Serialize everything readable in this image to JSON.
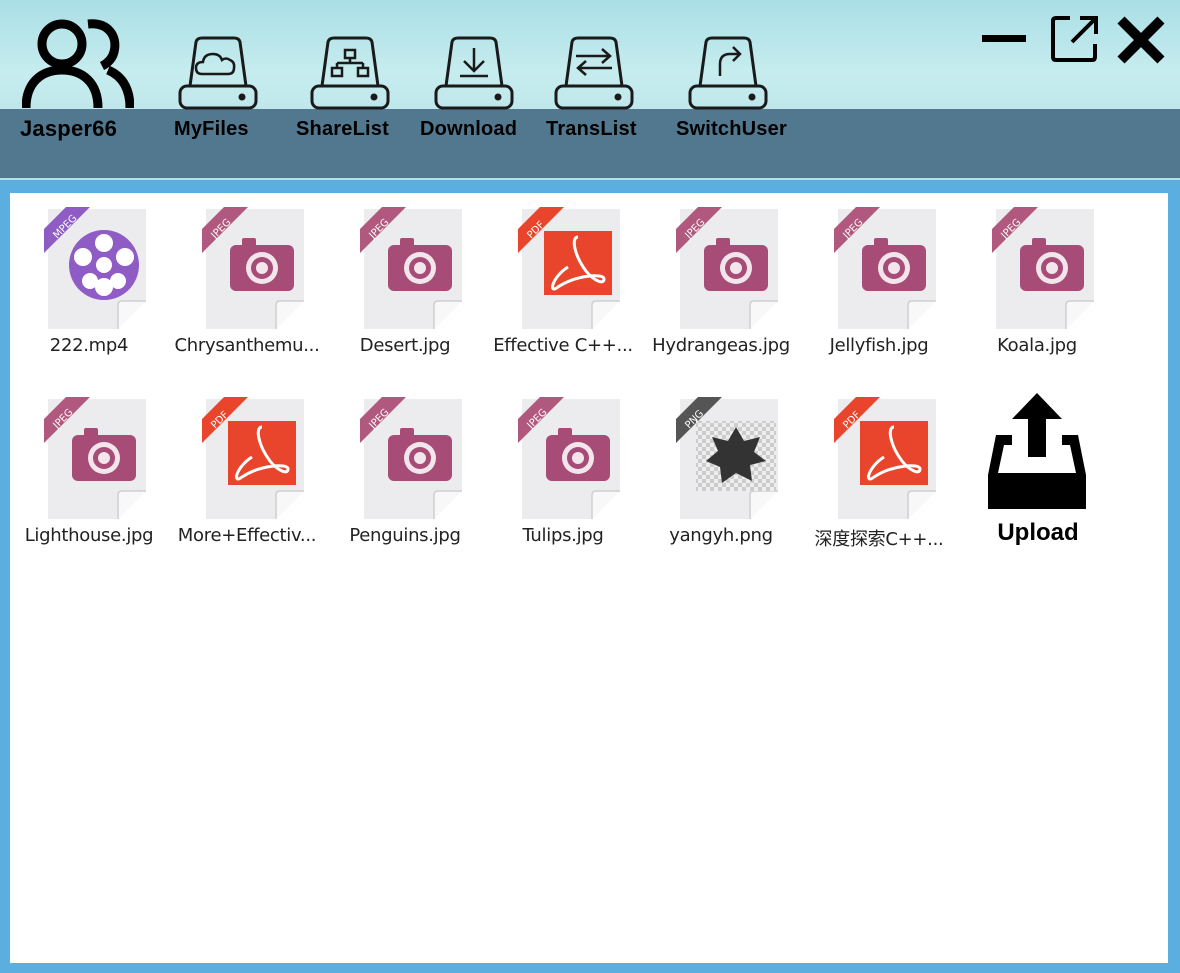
{
  "user": {
    "name": "Jasper66"
  },
  "nav": [
    {
      "id": "myfiles",
      "label": "MyFiles",
      "icon": "cloud-drive-icon"
    },
    {
      "id": "sharelist",
      "label": "ShareList",
      "icon": "share-drive-icon"
    },
    {
      "id": "download",
      "label": "Download",
      "icon": "download-drive-icon"
    },
    {
      "id": "translist",
      "label": "TransList",
      "icon": "transfer-drive-icon"
    },
    {
      "id": "switchuser",
      "label": "SwitchUser",
      "icon": "switch-drive-icon"
    }
  ],
  "window_controls": [
    "minimize-icon",
    "popout-icon",
    "close-icon"
  ],
  "files": [
    {
      "name": "222.mp4",
      "badge": "MPEG",
      "kind": "video"
    },
    {
      "name": "Chrysanthemu...",
      "badge": "JPEG",
      "kind": "image"
    },
    {
      "name": "Desert.jpg",
      "badge": "JPEG",
      "kind": "image"
    },
    {
      "name": "Effective C++...",
      "badge": "PDF",
      "kind": "pdf"
    },
    {
      "name": "Hydrangeas.jpg",
      "badge": "JPEG",
      "kind": "image"
    },
    {
      "name": "Jellyfish.jpg",
      "badge": "JPEG",
      "kind": "image"
    },
    {
      "name": "Koala.jpg",
      "badge": "JPEG",
      "kind": "image"
    },
    {
      "name": "Lighthouse.jpg",
      "badge": "JPEG",
      "kind": "image"
    },
    {
      "name": "More+Effectiv...",
      "badge": "PDF",
      "kind": "pdf"
    },
    {
      "name": "Penguins.jpg",
      "badge": "JPEG",
      "kind": "image"
    },
    {
      "name": "Tulips.jpg",
      "badge": "JPEG",
      "kind": "image"
    },
    {
      "name": "yangyh.png",
      "badge": "PNG",
      "kind": "png"
    },
    {
      "name": "深度探索C++...",
      "badge": "PDF",
      "kind": "pdf"
    }
  ],
  "upload": {
    "label": "Upload"
  },
  "colors": {
    "nav_band": "#52788f",
    "jpeg_badge": "#b0587d",
    "mpeg_badge": "#8e5cc4",
    "pdf_badge": "#e8452c",
    "png_badge": "#555555"
  }
}
